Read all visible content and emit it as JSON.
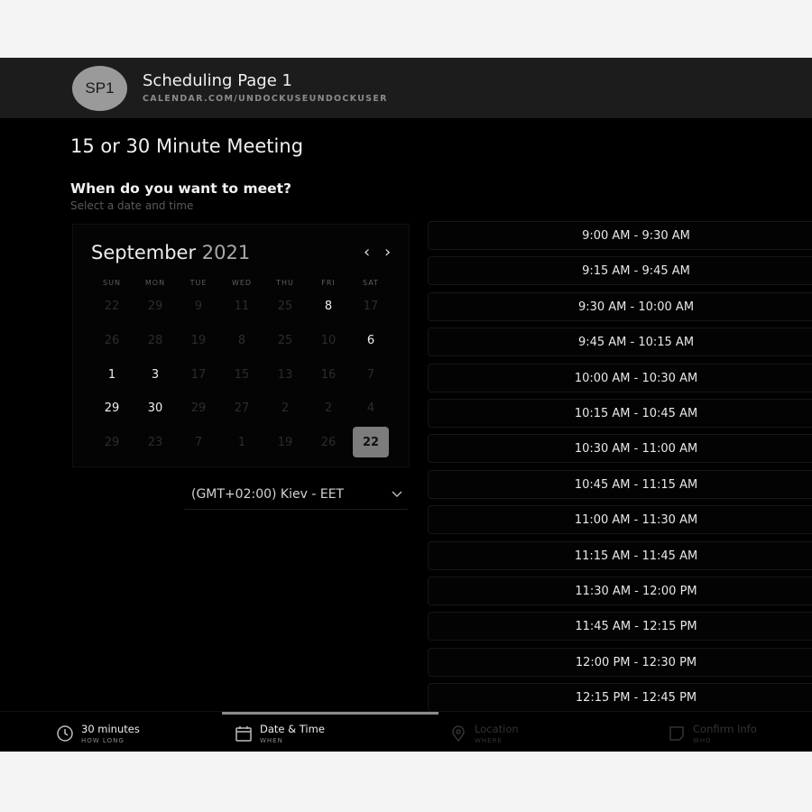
{
  "header": {
    "avatar_initials": "SP1",
    "page_name": "Scheduling Page 1",
    "url": "CALENDAR.COM/UNDOCKUSEUNDOCKUSER"
  },
  "meeting": {
    "title": "15 or 30 Minute Meeting",
    "question": "When do you want to meet?",
    "hint": "Select a date and time"
  },
  "calendar": {
    "month": "September",
    "year": "2021",
    "weekdays": [
      "SUN",
      "MON",
      "TUE",
      "WED",
      "THU",
      "FRI",
      "SAT"
    ],
    "weeks": [
      [
        {
          "d": "22",
          "on": false
        },
        {
          "d": "29",
          "on": false
        },
        {
          "d": "9",
          "on": false
        },
        {
          "d": "11",
          "on": false
        },
        {
          "d": "25",
          "on": false
        },
        {
          "d": "8",
          "on": true
        },
        {
          "d": "17",
          "on": false
        }
      ],
      [
        {
          "d": "26",
          "on": false
        },
        {
          "d": "28",
          "on": false
        },
        {
          "d": "19",
          "on": false
        },
        {
          "d": "8",
          "on": false
        },
        {
          "d": "25",
          "on": false
        },
        {
          "d": "10",
          "on": false
        },
        {
          "d": "6",
          "on": true
        }
      ],
      [
        {
          "d": "1",
          "on": true
        },
        {
          "d": "3",
          "on": true
        },
        {
          "d": "17",
          "on": false
        },
        {
          "d": "15",
          "on": false
        },
        {
          "d": "13",
          "on": false
        },
        {
          "d": "16",
          "on": false
        },
        {
          "d": "7",
          "on": false
        }
      ],
      [
        {
          "d": "29",
          "on": true
        },
        {
          "d": "30",
          "on": true
        },
        {
          "d": "29",
          "on": false
        },
        {
          "d": "27",
          "on": false
        },
        {
          "d": "2",
          "on": false
        },
        {
          "d": "2",
          "on": false
        },
        {
          "d": "4",
          "on": false
        }
      ],
      [
        {
          "d": "29",
          "on": false
        },
        {
          "d": "23",
          "on": false
        },
        {
          "d": "7",
          "on": false
        },
        {
          "d": "1",
          "on": false
        },
        {
          "d": "19",
          "on": false
        },
        {
          "d": "26",
          "on": false
        },
        {
          "d": "22",
          "on": true,
          "selected": true
        }
      ]
    ]
  },
  "timezone": {
    "label": "(GMT+02:00) Kiev - EET"
  },
  "time_slots": [
    "9:00 AM - 9:30 AM",
    "9:15 AM - 9:45 AM",
    "9:30 AM - 10:00 AM",
    "9:45 AM - 10:15 AM",
    "10:00 AM - 10:30 AM",
    "10:15 AM - 10:45 AM",
    "10:30 AM - 11:00 AM",
    "10:45 AM - 11:15 AM",
    "11:00 AM - 11:30 AM",
    "11:15 AM - 11:45 AM",
    "11:30 AM - 12:00 PM",
    "11:45 AM - 12:15 PM",
    "12:00 PM - 12:30 PM",
    "12:15 PM - 12:45 PM"
  ],
  "steps": [
    {
      "label": "30 minutes",
      "sub": "HOW LONG",
      "icon": "clock-icon",
      "state": "done"
    },
    {
      "label": "Date & Time",
      "sub": "WHEN",
      "icon": "calendar-icon",
      "state": "active"
    },
    {
      "label": "Location",
      "sub": "WHERE",
      "icon": "location-pin-icon",
      "state": "upcoming"
    },
    {
      "label": "Confirm Info",
      "sub": "WHO",
      "icon": "confirm-icon",
      "state": "upcoming"
    }
  ],
  "colors": {
    "background": "#000000",
    "header_bg": "#1c1c1c",
    "selected_day": "#7c7c7c",
    "active_step_bar": "#8c8c8c"
  }
}
